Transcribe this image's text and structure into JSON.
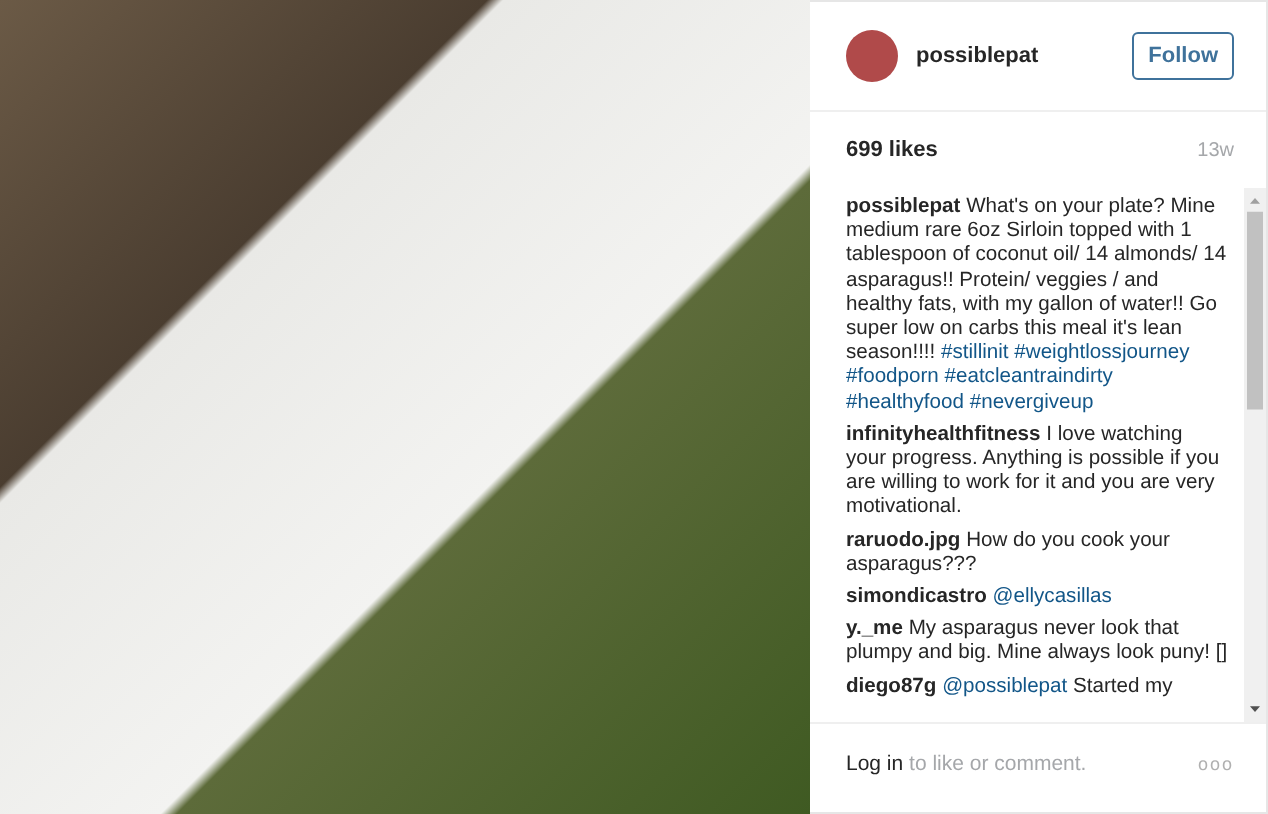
{
  "post": {
    "user": "possiblepat",
    "follow_button": "Follow",
    "likes": "699 likes",
    "age": "13w",
    "comments": [
      {
        "user": "possiblepat",
        "parts": [
          {
            "kind": "plain",
            "text": "What's on your plate? Mine medium rare 6oz Sirloin topped with 1 tablespoon of coconut oil/ 14 almonds/ 14 asparagus!! Protein/ veggies / and healthy fats, with my gallon of water!! Go super low on carbs this meal it's lean season!!!! "
          },
          {
            "kind": "link",
            "text": "#stillinit"
          },
          {
            "kind": "link",
            "text": "#weightlossjourney"
          },
          {
            "kind": "link",
            "text": "#foodporn"
          },
          {
            "kind": "link",
            "text": "#eatcleantraindirty"
          },
          {
            "kind": "link",
            "text": "#healthyfood"
          },
          {
            "kind": "link",
            "text": "#nevergiveup"
          }
        ]
      },
      {
        "user": "infinityhealthfitness",
        "parts": [
          {
            "kind": "plain",
            "text": "I love watching your progress. Anything is possible if you are willing to work for it and you are very motivational."
          }
        ]
      },
      {
        "user": "raruodo.jpg",
        "parts": [
          {
            "kind": "plain",
            "text": "How do you cook your asparagus???"
          }
        ]
      },
      {
        "user": "simondicastro",
        "parts": [
          {
            "kind": "link",
            "text": "@ellycasillas"
          }
        ]
      },
      {
        "user": "y._me",
        "parts": [
          {
            "kind": "plain",
            "text": "My asparagus never look that plumpy and big. Mine always look puny! []"
          }
        ]
      },
      {
        "user": "diego87g",
        "parts": [
          {
            "kind": "link",
            "text": "@possiblepat"
          },
          {
            "kind": "plain",
            "text": " Started my"
          }
        ]
      }
    ],
    "login_link": "Log in",
    "login_text": "to like or comment.",
    "more_button": "ooo"
  }
}
